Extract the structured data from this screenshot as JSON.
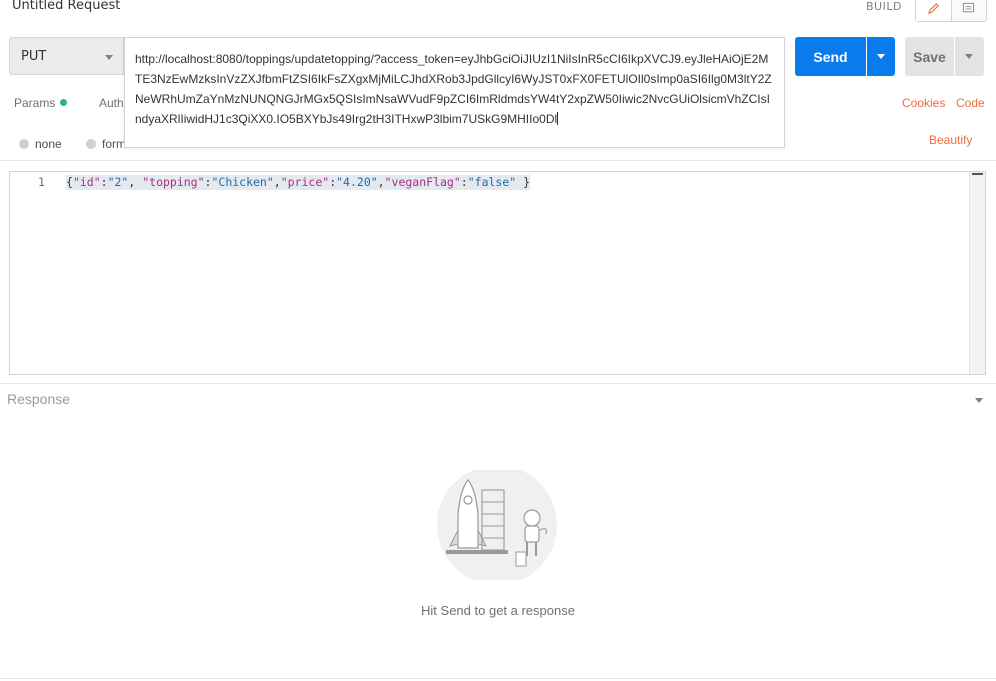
{
  "header": {
    "title": "Untitled Request",
    "build_label": "BUILD",
    "icons": [
      "pencil-icon",
      "comment-icon"
    ]
  },
  "request": {
    "method": "PUT",
    "url": "http://localhost:8080/toppings/updatetopping/?access_token=eyJhbGciOiJIUzI1NiIsInR5cCI6IkpXVCJ9.eyJleHAiOjE2MTE3NzEwMzksInVzZXJfbmFtZSI6IkFsZXgxMjMiLCJhdXRob3JpdGllcyI6WyJST0xFX0FETUlOIl0sImp0aSI6Ilg0M3ltY2ZNeWRhUmZaYnMzNUNQNGJrMGx5QSIsImNsaWVudF9pZCI6ImRldmdsYW4tY2xpZW50Iiwic2NvcGUiOlsicmVhZCIsIndyaXRlIiwidHJ1c3QiXX0.IO5BXYbJs49Irg2tH3ITHxwP3lbim7USkG9MHIIo0Dl",
    "send_label": "Send",
    "save_label": "Save"
  },
  "tabs": {
    "params": "Params",
    "auth": "Auth"
  },
  "links": {
    "cookies": "Cookies",
    "code": "Code",
    "beautify": "Beautify"
  },
  "body_modes": {
    "none": "none",
    "form": "form"
  },
  "editor": {
    "line_number": "1",
    "tokens": [
      {
        "t": "{",
        "c": "p"
      },
      {
        "t": "\"id\"",
        "c": "k"
      },
      {
        "t": ":",
        "c": "p"
      },
      {
        "t": "\"2\"",
        "c": "s"
      },
      {
        "t": ", ",
        "c": "p"
      },
      {
        "t": "\"topping\"",
        "c": "k"
      },
      {
        "t": ":",
        "c": "p"
      },
      {
        "t": "\"Chicken\"",
        "c": "s"
      },
      {
        "t": ",",
        "c": "p"
      },
      {
        "t": "\"price\"",
        "c": "k"
      },
      {
        "t": ":",
        "c": "p"
      },
      {
        "t": "\"4.20\"",
        "c": "s"
      },
      {
        "t": ",",
        "c": "p"
      },
      {
        "t": "\"veganFlag\"",
        "c": "k"
      },
      {
        "t": ":",
        "c": "p"
      },
      {
        "t": "\"false\"",
        "c": "s"
      },
      {
        "t": " }",
        "c": "p"
      }
    ]
  },
  "response": {
    "label": "Response",
    "empty_message": "Hit Send to get a response"
  },
  "colors": {
    "send": "#097bed",
    "accent_link": "#f26b3a",
    "status_dot": "#26b47f"
  }
}
